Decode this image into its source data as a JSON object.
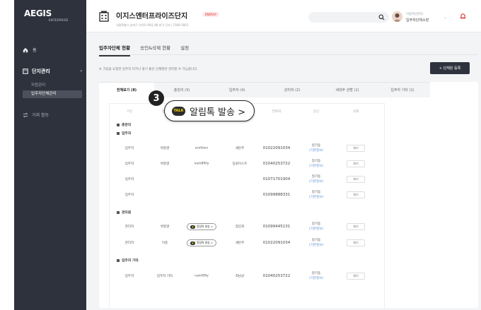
{
  "brand": {
    "name_main": "AEGIS",
    "name_sub": "ENTERPRISE"
  },
  "sidebar": {
    "home_label": "홈",
    "group_label": "단지관리",
    "sub_items": [
      {
        "label": "자원관리"
      },
      {
        "label": "입주자단체관리"
      }
    ],
    "trade_label": "거래 활동"
  },
  "header": {
    "site_name": "이지스엔터프라이즈단지",
    "site_badge": "ENERGY",
    "site_address": "서울특별시 송파구 가락로 99길 88 한국 단지 | 1566-5801",
    "search_placeholder": "",
    "user_name": "이용자(관리)",
    "user_role": "입주자단체소장",
    "icons": {
      "search": "search-icon",
      "bell": "bell-icon",
      "chevron": "chevron-down-icon"
    }
  },
  "tabs": [
    {
      "label": "입주자단체 현황",
      "active": true
    },
    {
      "label": "승인&삭제 현황",
      "active": false
    },
    {
      "label": "설정",
      "active": false
    }
  ],
  "notice": "※ 가입을 요청한 입주자 미가니 앞기 통인 인재명만 관리할 수 가능합니다.",
  "register_button": "+ 단체원 등록",
  "subtabs": [
    {
      "label": "전체보기 (8)",
      "active": true
    },
    {
      "label": "총관리 (3)",
      "active": false
    },
    {
      "label": "입주자 (4)",
      "active": false
    },
    {
      "label": "관리자 (2)",
      "active": false
    },
    {
      "label": "세대주 관할 (1)",
      "active": false
    },
    {
      "label": "입주자 기타 (1)",
      "active": false
    }
  ],
  "table": {
    "columns": [
      "구분",
      "성명",
      "아이디",
      "기업",
      "연락처",
      "승인",
      "삭제"
    ],
    "groups": [
      {
        "label": "총관리",
        "rows": []
      },
      {
        "label": "입주자",
        "rows": [
          {
            "type": "입주자",
            "name": "위정명",
            "id": "zsoltsev",
            "company": "세탄주",
            "phone": "01022091034",
            "approve_main": "일기동",
            "approve_link": "(기본정보)",
            "action": "회기"
          },
          {
            "type": "입주자",
            "name": "위정명",
            "id": "nam89lly",
            "company": "동원이스트",
            "phone": "01040253722",
            "approve_main": "일기동",
            "approve_link": "(기본정보)",
            "action": "회기"
          },
          {
            "type": "입주자",
            "name": "",
            "id": "",
            "company": "",
            "phone": "01071701904",
            "approve_main": "일기동",
            "approve_link": "(기본정보)",
            "action": "회기"
          },
          {
            "type": "입주자",
            "name": "",
            "id": "",
            "company": "",
            "phone": "01099888331",
            "approve_main": "일기동",
            "approve_link": "(기본정보)",
            "action": "회기"
          }
        ]
      },
      {
        "label": "관리원",
        "rows": [
          {
            "type": "관리자",
            "name": "위정명",
            "id_pill": "알림톡 발송 >",
            "company": "정민희",
            "phone": "01099445131",
            "approve_main": "일기동",
            "approve_link": "(기본정보)",
            "action": "회기"
          },
          {
            "type": "관리자",
            "name": "이종",
            "id_pill": "알림톡 발송 >",
            "company": "세탄주",
            "phone": "01022091034",
            "approve_main": "일기동",
            "approve_link": "(기본정보)",
            "action": "회기"
          }
        ]
      },
      {
        "label": "입주자 기타",
        "rows": [
          {
            "type": "입주자",
            "name": "입주자 기타",
            "id": "nam99ly",
            "company": "최남균",
            "phone": "01040253722",
            "approve_main": "일기동",
            "approve_link": "(기본정보)",
            "action": "회기"
          }
        ]
      }
    ]
  },
  "callout": {
    "step": "3",
    "badge": "TALK",
    "text": "알림톡 발송 >"
  }
}
